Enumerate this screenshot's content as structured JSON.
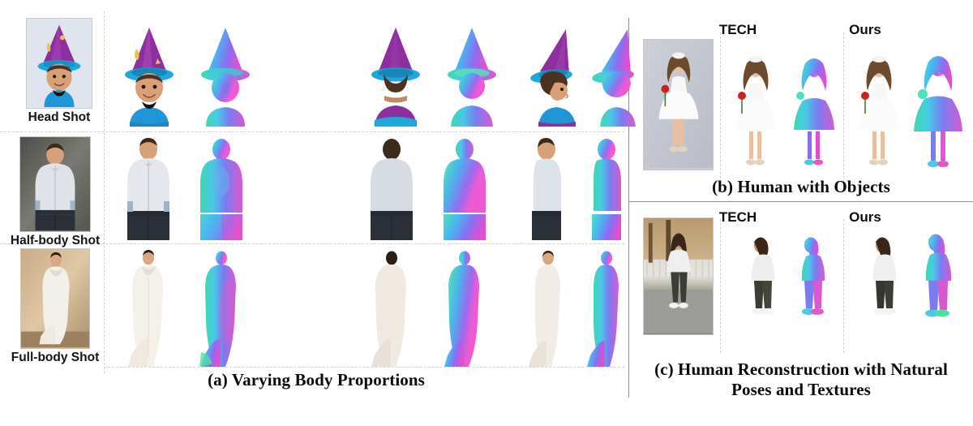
{
  "figure": {
    "kind": "research-figure",
    "background": "#ffffff",
    "panels": [
      {
        "id": "a",
        "caption": "(a) Varying Body Proportions",
        "rows": [
          {
            "label": "Head Shot",
            "input_bg": "#dfe4ee"
          },
          {
            "label": "Half-body Shot",
            "input_bg": "#6a6a66"
          },
          {
            "label": "Full-body Shot",
            "input_bg": "#c9a882"
          }
        ],
        "view_columns": [
          "front-rgb",
          "front-normal",
          "back-rgb",
          "back-normal",
          "left-rgb",
          "left-normal",
          "right-rgb",
          "right-normal"
        ]
      },
      {
        "id": "b",
        "caption": "(b) Human with Objects",
        "column_labels": [
          "TECH",
          "Ours"
        ],
        "input_bg": "#c9ccd6"
      },
      {
        "id": "c",
        "caption": "(c) Human Reconstruction with Natural\nPoses and Textures",
        "column_labels": [
          "TECH",
          "Ours"
        ],
        "input_bg": "#9a7f5e"
      }
    ],
    "colors": {
      "divider_solid": "#8d8d8d",
      "divider_dashed": "#d0d0d0",
      "caption_text": "#0a0a0a",
      "label_text": "#141414",
      "normal_map_magenta": "#e040c8",
      "normal_map_cyan": "#2fd4e8",
      "normal_map_blue": "#5b6ef0",
      "normal_map_green": "#4fe0a0",
      "hat_purple": "#8e2f9e",
      "hat_blue": "#1fa8dd",
      "skin": "#d9a077",
      "shirt_blue": "#2196d6",
      "dress_white": "#f3efe9",
      "jeans_dark": "#2b2f38"
    }
  }
}
